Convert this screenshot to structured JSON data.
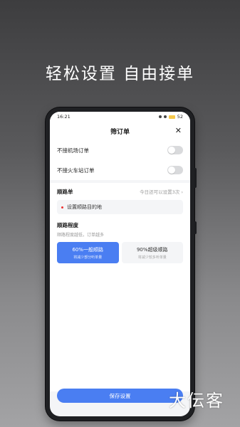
{
  "headline": "轻松设置 自由接单",
  "status": {
    "time": "16:21",
    "battery": "52"
  },
  "sheet": {
    "title": "筛订单",
    "close_icon": "close-icon"
  },
  "toggles": [
    {
      "label": "不接机场订单",
      "on": false
    },
    {
      "label": "不接火车站订单",
      "on": false
    }
  ],
  "route": {
    "title": "顺路单",
    "hint": "今日还可以设置3次",
    "placeholder": "设置顺路目的地"
  },
  "level": {
    "title": "顺路程度",
    "subtitle": "顺路程度越低，订单越多",
    "options": [
      {
        "title": "60%一般顺路",
        "sub": "将减少部分听单量",
        "selected": true
      },
      {
        "title": "90%超级顺路",
        "sub": "将减少较多听单量",
        "selected": false
      }
    ]
  },
  "save_button": "保存设置",
  "watermark": "大伝客",
  "colors": {
    "accent": "#4a7ef2",
    "toggle_off": "#d9dadc"
  }
}
